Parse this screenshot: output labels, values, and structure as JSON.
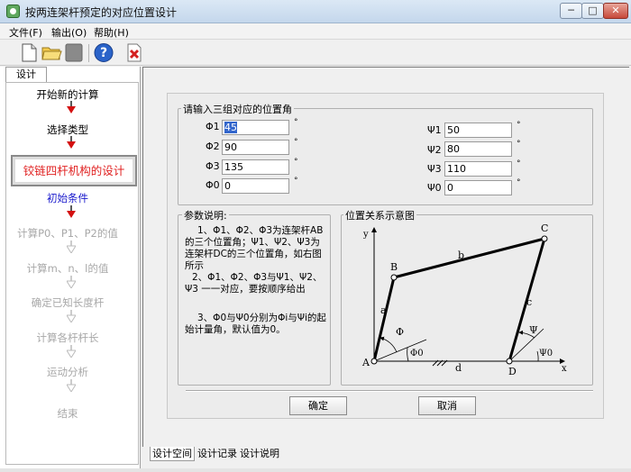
{
  "window": {
    "title": "按两连架杆预定的对应位置设计"
  },
  "menu": [
    "文件(F)",
    "输出(O)",
    "帮助(H)"
  ],
  "toolbar": {
    "icons": [
      "new-file-icon",
      "open-folder-icon",
      "save-icon",
      "help-icon",
      "exit-icon"
    ]
  },
  "left": {
    "tab_label": "设计",
    "steps": {
      "s1": "开始新的计算",
      "s2": "选择类型",
      "s3": "铰链四杆机构的设计",
      "s4": "初始条件",
      "s5": "计算P0、P1、P2的值",
      "s6": "计算m、n、l的值",
      "s7": "确定已知长度杆",
      "s8": "计算各杆杆长",
      "s9": "运动分析",
      "s10": "结束"
    }
  },
  "input_group": {
    "title": "请输入三组对应的位置角",
    "phi_labels": [
      "Φ1",
      "Φ2",
      "Φ3",
      "Φ0"
    ],
    "phi_values": [
      "45",
      "90",
      "135",
      "0"
    ],
    "psi_labels": [
      "Ψ1",
      "Ψ2",
      "Ψ3",
      "Ψ0"
    ],
    "psi_values": [
      "50",
      "80",
      "110",
      "0"
    ],
    "degree": "°"
  },
  "description": {
    "title": "参数说明:",
    "p1": "1、Φ1、Φ2、Φ3为连架杆AB的三个位置角；Ψ1、Ψ2、Ψ3为连架杆DC的三个位置角，如右图所示",
    "p2": "2、Φ1、Φ2、Φ3与Ψ1、Ψ2、Ψ3 一一对应，要按顺序给出",
    "p3": "3、Φ0与Ψ0分别为Φi与Ψi的起始计量角，默认值为0。"
  },
  "diagram": {
    "title": "位置关系示意图",
    "labels": {
      "A": "A",
      "B": "B",
      "C": "C",
      "D": "D",
      "a": "a",
      "b": "b",
      "c": "c",
      "d": "d",
      "x": "x",
      "y": "y",
      "phi": "Φ",
      "phi0": "Φ0",
      "psi": "Ψ",
      "psi0": "Ψ0"
    }
  },
  "buttons": {
    "ok": "确定",
    "cancel": "取消"
  },
  "bottom_tabs": [
    "设计空间",
    "设计记录",
    "设计说明"
  ],
  "window_buttons": {
    "min": "─",
    "max": "□",
    "close": "✕"
  }
}
